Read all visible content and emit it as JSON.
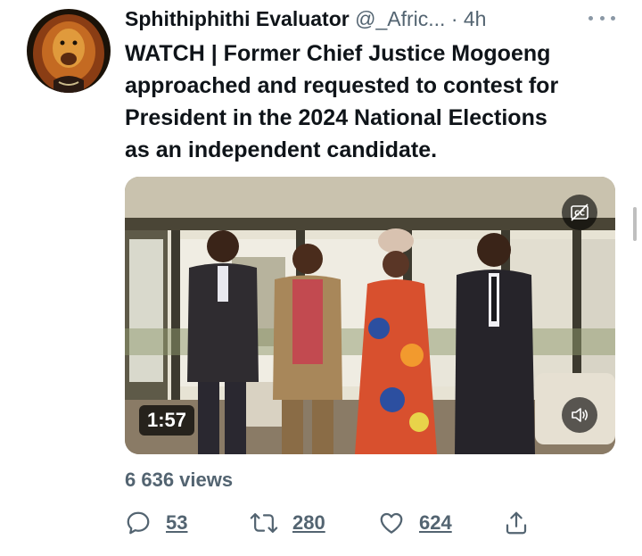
{
  "tweet": {
    "display_name": "Sphithiphithi Evaluator",
    "handle": "@_Afric...",
    "separator": "·",
    "time": "4h",
    "text": "WATCH | Former Chief Justice Mogoeng\napproached and requested to contest for\nPresident in the 2024 National Elections\nas an independent candidate."
  },
  "video": {
    "duration": "1:57",
    "cc_icon": "closed-captions-off-icon",
    "mute_icon": "speaker-muted-icon"
  },
  "stats": {
    "views": "6 636 views"
  },
  "actions": {
    "reply_count": "53",
    "retweet_count": "280",
    "like_count": "624"
  },
  "colors": {
    "text_primary": "#0f1419",
    "text_secondary": "#536471"
  }
}
